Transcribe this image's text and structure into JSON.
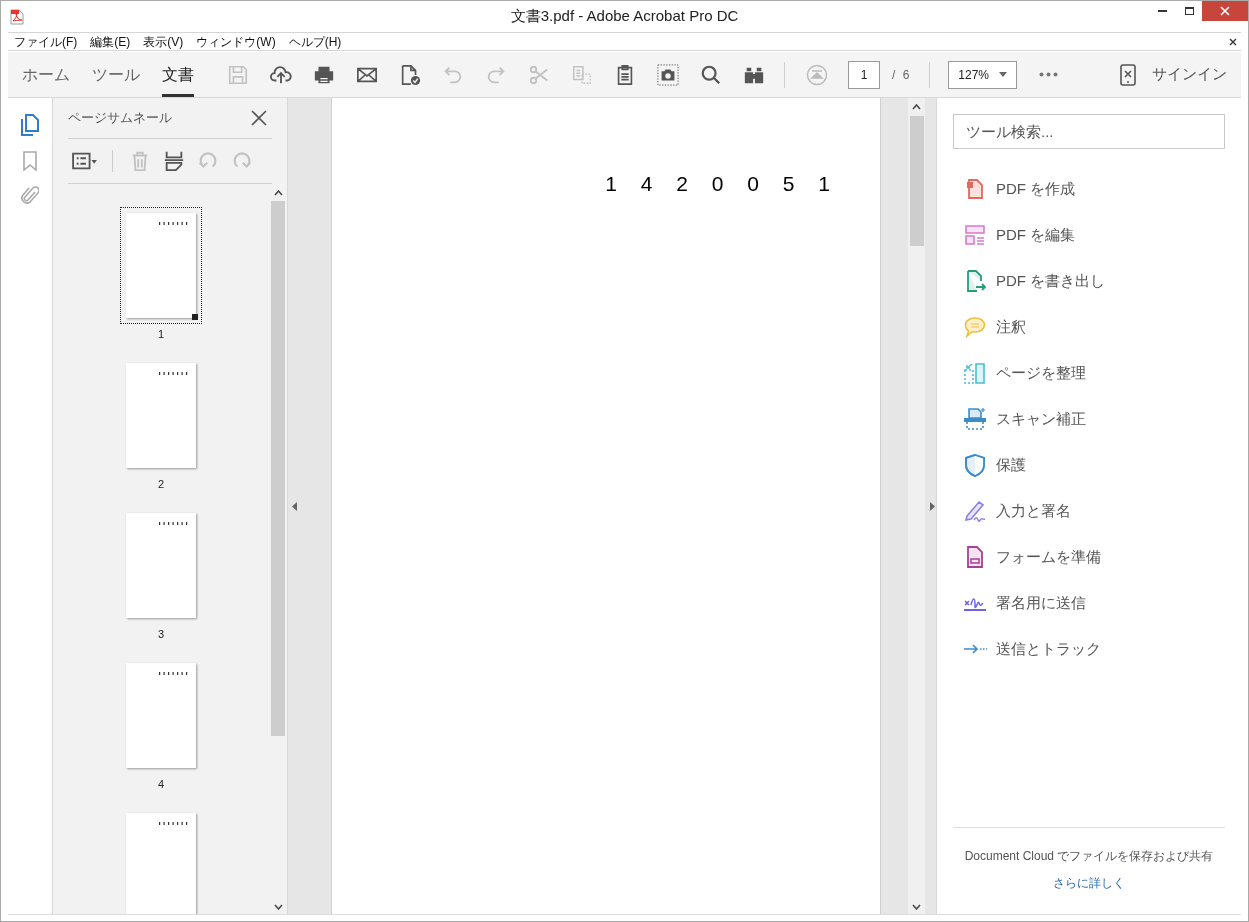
{
  "window": {
    "title": "文書3.pdf - Adobe Acrobat Pro DC"
  },
  "menu": [
    "ファイル(F)",
    "編集(E)",
    "表示(V)",
    "ウィンドウ(W)",
    "ヘルプ(H)"
  ],
  "tabs": [
    {
      "label": "ホーム",
      "selected": false
    },
    {
      "label": "ツール",
      "selected": false
    },
    {
      "label": "文書",
      "selected": true
    }
  ],
  "toolbar": {
    "buttons": [
      {
        "kind": "save",
        "disabled": true
      },
      {
        "kind": "upload",
        "disabled": false
      },
      {
        "kind": "print",
        "disabled": false
      },
      {
        "kind": "mail",
        "disabled": false
      },
      {
        "kind": "spellcheck",
        "disabled": false
      },
      {
        "kind": "undo",
        "disabled": true
      },
      {
        "kind": "redo",
        "disabled": true
      },
      {
        "kind": "cut",
        "disabled": true
      },
      {
        "kind": "copy",
        "disabled": true
      },
      {
        "kind": "clipboard",
        "disabled": false
      },
      {
        "kind": "snapshot",
        "disabled": false
      },
      {
        "kind": "search",
        "disabled": false
      },
      {
        "kind": "binoculars",
        "disabled": false
      }
    ],
    "page_number": "1",
    "page_total": "/ 6",
    "zoom": "127%",
    "sign_in": "サインイン"
  },
  "thumbnail_panel": {
    "title": "ページサムネール",
    "tools": [
      {
        "kind": "options",
        "disabled": false
      },
      {
        "kind": "delete",
        "disabled": true
      },
      {
        "kind": "insert",
        "disabled": false
      },
      {
        "kind": "rotate_ccw",
        "disabled": true
      },
      {
        "kind": "rotate_cw",
        "disabled": true
      }
    ],
    "thumbnails": [
      {
        "label": "1",
        "selected": true
      },
      {
        "label": "2",
        "selected": false
      },
      {
        "label": "3",
        "selected": false
      },
      {
        "label": "4",
        "selected": false
      },
      {
        "selected": false
      }
    ]
  },
  "document": {
    "text": "1 4 2 0 0 5 1"
  },
  "tools_pane": {
    "search_placeholder": "ツール検索...",
    "tools": [
      {
        "kind": "create",
        "label": "PDF を作成"
      },
      {
        "kind": "edit",
        "label": "PDF を編集"
      },
      {
        "kind": "export",
        "label": "PDF を書き出し"
      },
      {
        "kind": "comment",
        "label": "注釈"
      },
      {
        "kind": "organize",
        "label": "ページを整理"
      },
      {
        "kind": "scan",
        "label": "スキャン補正"
      },
      {
        "kind": "protect",
        "label": "保護"
      },
      {
        "kind": "fill_sign",
        "label": "入力と署名"
      },
      {
        "kind": "form",
        "label": "フォームを準備"
      },
      {
        "kind": "send_sign",
        "label": "署名用に送信"
      },
      {
        "kind": "send_track",
        "label": "送信とトラック"
      }
    ],
    "footer_text": "Document Cloud でファイルを保存および共有",
    "footer_link": "さらに詳しく"
  }
}
